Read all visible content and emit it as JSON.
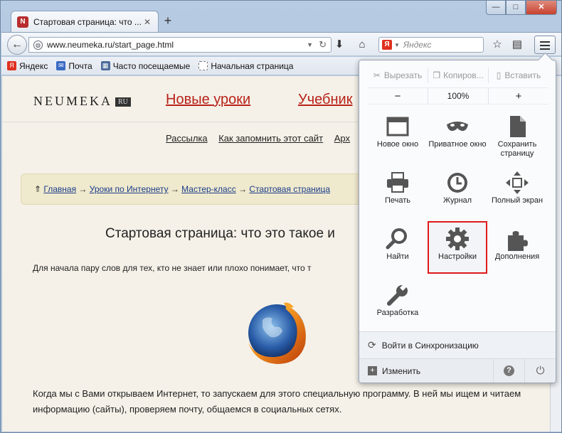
{
  "tab": {
    "title": "Стартовая страница: что ...",
    "favicon": "N"
  },
  "window": {
    "minimize": "—",
    "maximize": "□",
    "close": "✕"
  },
  "navbar": {
    "url": "www.neumeka.ru/start_page.html",
    "search_engine": "Я",
    "search_placeholder": "Яндекс"
  },
  "bookmarks": {
    "items": [
      {
        "label": "Яндекс",
        "icon": "yandex-icon"
      },
      {
        "label": "Почта",
        "icon": "mail-icon"
      },
      {
        "label": "Часто посещаемые",
        "icon": "folder-icon"
      },
      {
        "label": "Начальная страница",
        "icon": "page-icon"
      }
    ]
  },
  "page": {
    "logo": "NEUMEKA",
    "logo_suffix": "RU",
    "nav": [
      "Новые уроки",
      "Учебник"
    ],
    "sublinks": [
      "Рассылка",
      "Как запомнить этот сайт",
      "Арх"
    ],
    "breadcrumbs": [
      "Главная",
      "Уроки по Интернету",
      "Мастер-класс",
      "Стартовая страница"
    ],
    "title": "Стартовая страница: что это такое и",
    "intro": "Для начала пару слов для тех, кто не знает или плохо понимает, что т",
    "paragraph": "Когда мы с Вами открываем Интернет, то запускаем для этого специальную программу. В ней мы ищем и читаем информацию (сайты), проверяем почту, общаемся в социальных сетях."
  },
  "menu": {
    "cut": "Вырезать",
    "copy": "Копиров...",
    "paste": "Вставить",
    "zoom_out": "−",
    "zoom": "100%",
    "zoom_in": "+",
    "items": [
      {
        "label": "Новое окно",
        "icon": "new-window-icon"
      },
      {
        "label": "Приватное окно",
        "icon": "private-window-icon"
      },
      {
        "label": "Сохранить страницу",
        "icon": "save-page-icon"
      },
      {
        "label": "Печать",
        "icon": "print-icon"
      },
      {
        "label": "Журнал",
        "icon": "history-icon"
      },
      {
        "label": "Полный экран",
        "icon": "fullscreen-icon"
      },
      {
        "label": "Найти",
        "icon": "find-icon"
      },
      {
        "label": "Настройки",
        "icon": "settings-icon",
        "highlighted": true
      },
      {
        "label": "Дополнения",
        "icon": "addons-icon"
      },
      {
        "label": "Разработка",
        "icon": "developer-icon"
      }
    ],
    "sync": "Войти в Синхронизацию",
    "customize": "Изменить"
  }
}
